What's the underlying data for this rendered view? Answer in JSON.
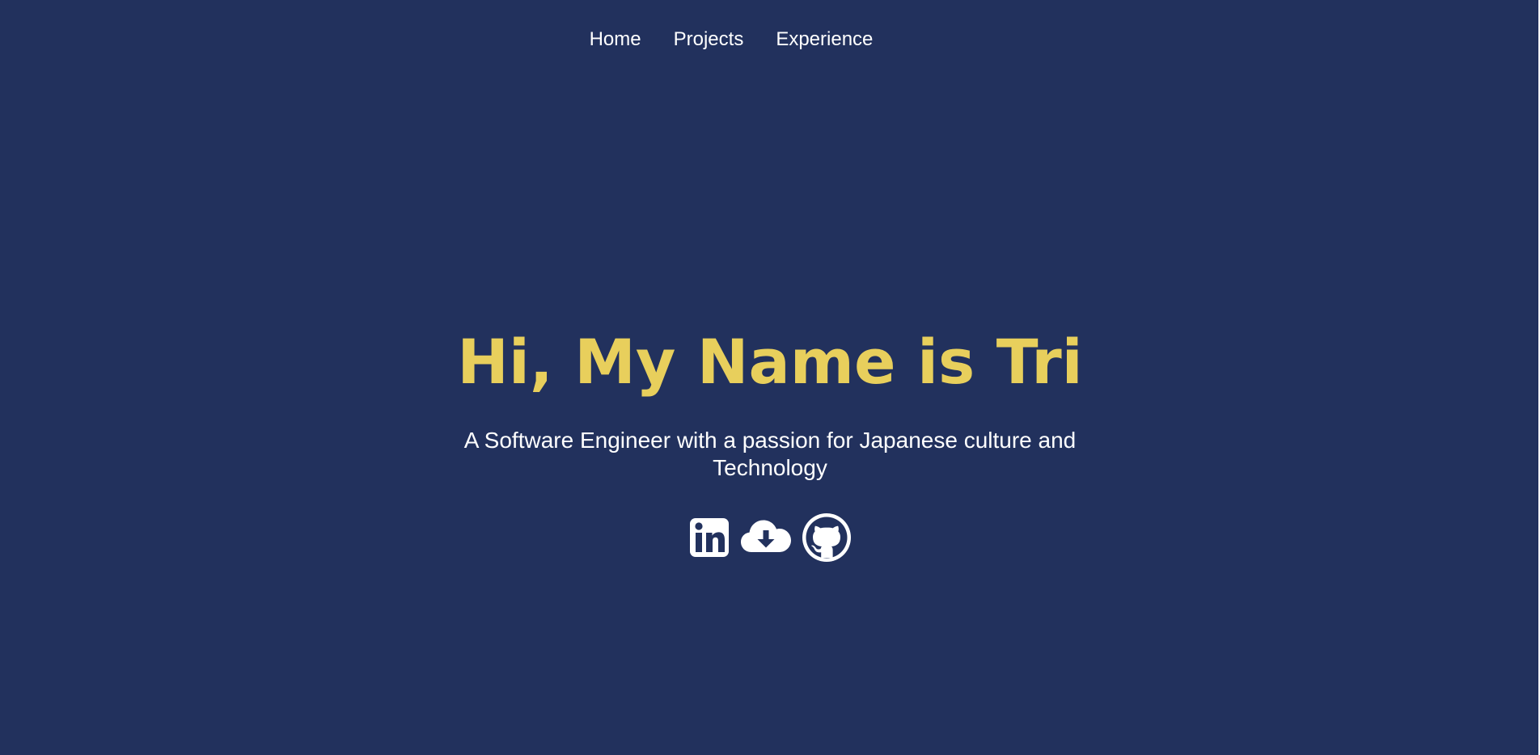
{
  "nav": {
    "items": [
      {
        "label": "Home"
      },
      {
        "label": "Projects"
      },
      {
        "label": "Experience"
      }
    ]
  },
  "hero": {
    "title": "Hi, My Name is Tri",
    "tagline": "A Software Engineer with a passion for Japanese culture and Technology"
  },
  "social": {
    "icons": [
      "linkedin-icon",
      "cloud-download-icon",
      "github-icon"
    ]
  },
  "colors": {
    "background": "#22315d",
    "accent": "#e8cf5c",
    "text": "#ffffff"
  }
}
